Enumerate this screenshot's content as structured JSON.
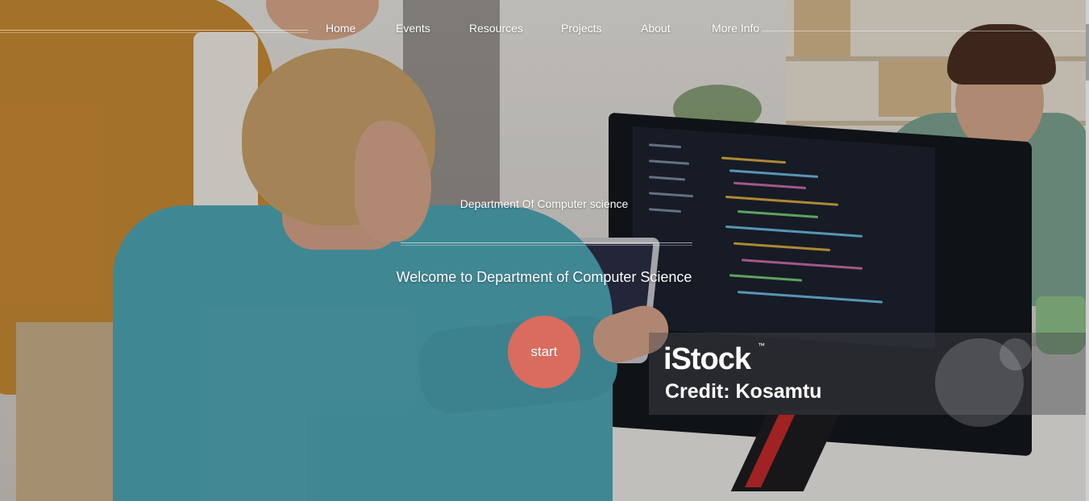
{
  "nav": {
    "items": [
      "Home",
      "Events",
      "Resources",
      "Projects",
      "About",
      "More Info"
    ]
  },
  "hero": {
    "subtitle": "Department Of Computer science",
    "title": "Welcome to Department of Computer Science",
    "start_label": "start"
  },
  "watermark": {
    "logo": "iStock",
    "tm": "™",
    "credit": "Credit: Kosamtu"
  },
  "colors": {
    "start_button": "#d96c5e",
    "nav_text": "#ffffff"
  }
}
